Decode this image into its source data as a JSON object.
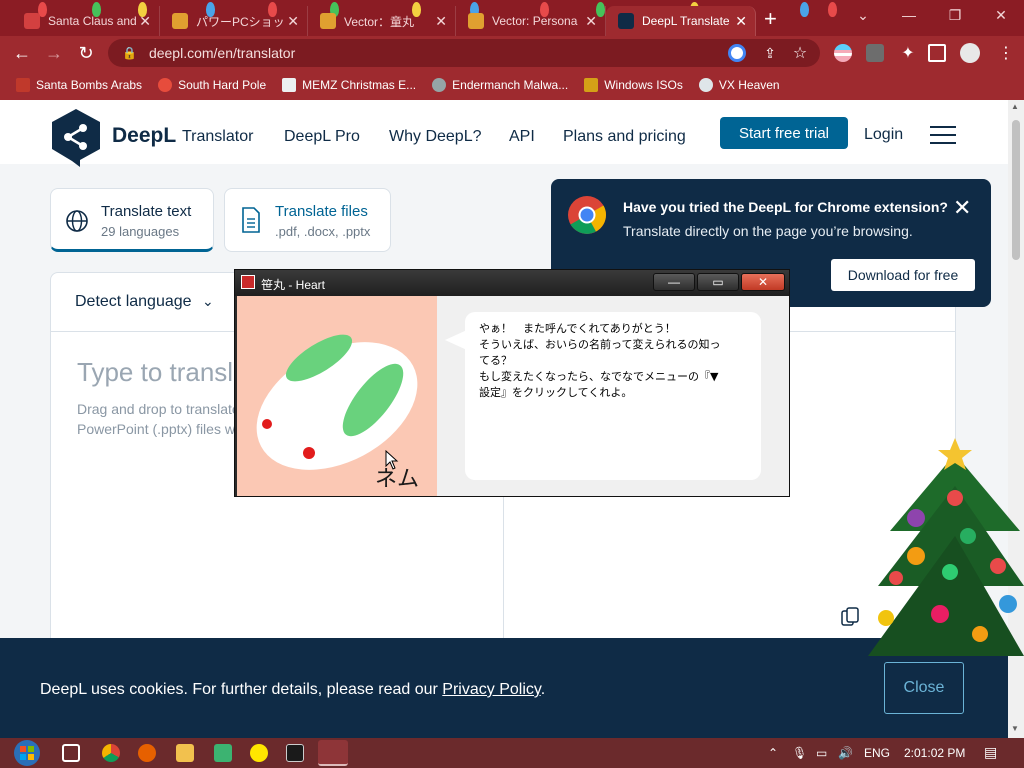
{
  "browser": {
    "tabs": [
      {
        "title": "Santa Claus and",
        "active": false
      },
      {
        "title": "パワーPCショップ",
        "active": false
      },
      {
        "title": "Vector：童丸 ",
        "active": false
      },
      {
        "title": "Vector: Persona",
        "active": false
      },
      {
        "title": "DeepL Translate",
        "active": true
      }
    ],
    "new_tab": "+",
    "url": "deepl.com/en/translator",
    "bookmarks": [
      "Santa Bombs Arabs",
      "South Hard Pole",
      "MEMZ Christmas E...",
      "Endermanch Malwa...",
      "Windows ISOs",
      "VX Heaven"
    ]
  },
  "site": {
    "brand": "DeepL",
    "brand_sub": "Translator",
    "nav": [
      "DeepL Pro",
      "Why DeepL?",
      "API",
      "Plans and pricing"
    ],
    "trial_button": "Start free trial",
    "login": "Login",
    "modes": [
      {
        "title": "Translate text",
        "sub": "29 languages"
      },
      {
        "title": "Translate files",
        "sub": ".pdf, .docx, .pptx"
      }
    ],
    "source_lang": "Detect language",
    "placeholder": "Type to translate",
    "hint_line1": "Drag and drop to translate",
    "hint_line2": "PowerPoint (.pptx) files w"
  },
  "chrome_promo": {
    "heading": "Have you tried the DeepL for Chrome extension?",
    "sub": "Translate directly on the page you’re browsing.",
    "download": "Download for free"
  },
  "cookie": {
    "text": "DeepL uses cookies. For further details, please read our",
    "link": "Privacy Policy",
    "tail": ".",
    "close": "Close"
  },
  "popup": {
    "title": "笹丸 - Heart",
    "lines": [
      "やぁ！　また呼んでくれてありがとう！",
      "そういえば、おいらの名前って変えられるの知っ",
      "てる？",
      "もし変えたくなったら、なでなでメニューの『▼",
      "設定』をクリックしてくれよ。"
    ],
    "signature": "ネム"
  },
  "taskbar": {
    "lang": "ENG",
    "time": "2:01:02 PM"
  },
  "colors": {
    "chrome_frame": "#9e2a2f",
    "deepl_navy": "#0f2b46",
    "deepl_blue": "#006494"
  }
}
